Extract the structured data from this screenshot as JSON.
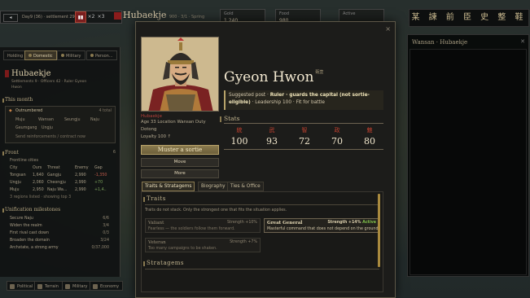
{
  "colors": {
    "accent": "#b8a36a",
    "faction_red": "#b4403a",
    "active_green": "#7fbf4a",
    "stat_kanji": "#c0412f"
  },
  "topbar": {
    "date": "Day9 (36) · settlement 29",
    "arrow": "◂",
    "speeds": [
      "▮▮",
      "×2",
      "×3"
    ],
    "faction": "Hubaekje",
    "faction_stats": "900 · 3/1 · Spring",
    "resources": [
      {
        "label": "Gold",
        "value": "1,240"
      },
      {
        "label": "Food",
        "value": "980"
      },
      {
        "label": "Active",
        "value": ""
      }
    ],
    "right_title": "某 諫 前 臣 史 整 鞋"
  },
  "left": {
    "tabs": [
      "Holding",
      "Domestic",
      "Military",
      "Person..."
    ],
    "title": "Hubaekje",
    "sub": "Settlements 9 · Officers 42 · Ruler Gyeon",
    "sub2": "Hwon",
    "this_month": "This month",
    "this_month_right": "",
    "outnumbered": "Outnumbered",
    "outnumbered_right": "4 total",
    "regions": [
      "Muju",
      "Wansan",
      "Seungju",
      "Naju"
    ],
    "regions2": [
      "Geumgang",
      "Ungju"
    ],
    "send_note": "Send reinforcements / contract now",
    "front": "Front",
    "front_right": "6",
    "frontlines": "Frontline cities",
    "cols": [
      "City",
      "Ours",
      "Threat",
      "Enemy",
      "Gap"
    ],
    "rows": [
      {
        "city": "Tongsan",
        "ours": "1,640",
        "threat": "Gangju",
        "enemy": "2,990",
        "gap": "-1,350"
      },
      {
        "city": "Ungju",
        "ours": "2,060",
        "threat": "Cheongju",
        "enemy": "2,990",
        "gap": "+70"
      },
      {
        "city": "Muju",
        "ours": "2,950",
        "threat": "Naju Wa...",
        "enemy": "2,990",
        "gap": "+1,4.."
      }
    ],
    "front_note": "3 regions listed · showing top 3",
    "milestones": "Unification milestones",
    "ms": [
      {
        "t": "Secure Naju",
        "r": "6/6"
      },
      {
        "t": "Widen the realm",
        "r": "3/4"
      },
      {
        "t": "First rival cast down",
        "r": "0/3"
      },
      {
        "t": "Broaden the domain",
        "r": "3/24"
      },
      {
        "t": "Archstate, a strong army",
        "r": "0/37,000"
      }
    ]
  },
  "right_panel": {
    "title": "Wansan · Hubaekje",
    "close": "✕"
  },
  "bottom": {
    "tabs": [
      "Political",
      "Terrain",
      "Military",
      "Economy"
    ]
  },
  "modal": {
    "close": "×",
    "faction": "Hubaekje",
    "age_line": "Age 33   Location Wansan   Duty",
    "duty": "Dotong",
    "loyalty": "Loyalty 100 ↑",
    "btn_sortie": "Muster a sortie",
    "btn_move": "Move",
    "btn_more": "More",
    "name": "Gyeon Hwon",
    "name_kanji": "甄萱",
    "post_prefix": "Suggested post · ",
    "post_bold": "Ruler · guards the capital (not sortie-eligible)",
    "post_suffix": " · Leadership 100 · Fit for battle",
    "stats_label": "Stats",
    "stats": [
      {
        "k": "統",
        "v": "100"
      },
      {
        "k": "武",
        "v": "93"
      },
      {
        "k": "智",
        "v": "72"
      },
      {
        "k": "政",
        "v": "70"
      },
      {
        "k": "魅",
        "v": "80"
      }
    ],
    "tabs": [
      "Traits & Stratagems",
      "Biography",
      "Ties & Office"
    ],
    "traits_label": "Traits",
    "traits_note": "Traits do not stack. Only the strongest one that fits the situation applies.",
    "traits": [
      {
        "name": "Valiant",
        "right": "Strength +10%",
        "desc": "Fearless — the soldiers follow them forward.",
        "on": false
      },
      {
        "name": "Great General",
        "right": "Strength +14%",
        "active": "Active",
        "desc": "Masterful command that does not depend on the ground.",
        "on": true
      },
      {
        "name": "Veteran",
        "right": "Strength +7%",
        "desc": "Too many campaigns to be shaken.",
        "on": false
      }
    ],
    "strat_label": "Stratagems"
  }
}
